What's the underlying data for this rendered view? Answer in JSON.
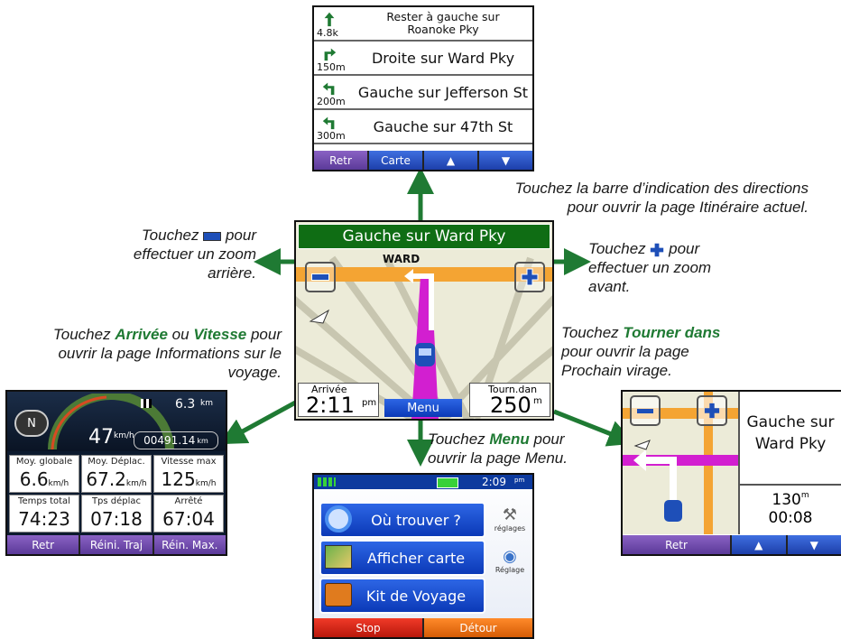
{
  "colors": {
    "arrow": "#1f7a33",
    "accent_green": "#1f7a33",
    "softkey_purple": "#5b3a99",
    "softkey_blue": "#1d3faa"
  },
  "route_screen": {
    "rows": [
      {
        "distance": "4.8k",
        "text": "Rester à gauche sur\nRoanoke Pky",
        "icon": "keep-left-icon"
      },
      {
        "distance": "150m",
        "text": "Droite sur Ward Pky",
        "icon": "turn-right-icon"
      },
      {
        "distance": "200m",
        "text": "Gauche sur Jefferson St",
        "icon": "turn-left-icon"
      },
      {
        "distance": "300m",
        "text": "Gauche sur 47th St",
        "icon": "turn-left-icon"
      }
    ],
    "buttons": {
      "back": "Retr",
      "map": "Carte",
      "up": "▲",
      "down": "▼"
    }
  },
  "map_screen": {
    "banner": "Gauche sur Ward Pky",
    "street_label": "WARD",
    "zoom_out": "−",
    "zoom_in": "+",
    "arrival_label": "Arrivée",
    "arrival_value": "2:11",
    "arrival_unit": "pm",
    "menu": "Menu",
    "turn_label": "Tourn.dan",
    "turn_value": "250",
    "turn_unit": "m"
  },
  "trip_screen": {
    "compass": "N",
    "speed": "47",
    "speed_unit": "km/h",
    "distance": "6.3",
    "distance_unit": "km",
    "odometer": "00491.14",
    "odometer_unit": "km",
    "stats": [
      {
        "label": "Moy. globale",
        "value": "6.6",
        "unit": "km/h"
      },
      {
        "label": "Moy. Déplac.",
        "value": "67.2",
        "unit": "km/h"
      },
      {
        "label": "Vitesse max",
        "value": "125",
        "unit": "km/h"
      },
      {
        "label": "Temps total",
        "value": "74:23",
        "unit": ""
      },
      {
        "label": "Tps déplac",
        "value": "07:18",
        "unit": ""
      },
      {
        "label": "Arrêté",
        "value": "67:04",
        "unit": ""
      }
    ],
    "buttons": {
      "back": "Retr",
      "reset_trip": "Réini. Traj",
      "reset_max": "Réin. Max."
    }
  },
  "menu_screen": {
    "time": "2:09",
    "time_unit": "pm",
    "buttons": [
      "Où trouver ?",
      "Afficher carte",
      "Kit de Voyage"
    ],
    "side": [
      "réglages",
      "Réglage"
    ],
    "stop": "Stop",
    "detour": "Détour"
  },
  "next_turn_screen": {
    "instruction": "Gauche sur\nWard Pky",
    "distance": "130",
    "distance_unit": "m",
    "time": "00:08",
    "buttons": {
      "back": "Retr",
      "up": "▲",
      "down": "▼"
    }
  },
  "captions": {
    "top_1": "Touchez la barre d’indication des directions",
    "top_2": "pour ouvrir la page Itinéraire actuel.",
    "left_zoom_pre": "Touchez",
    "left_zoom_post": "pour",
    "left_zoom_2": "effectuer un zoom",
    "left_zoom_3": "arrière.",
    "right_zoom_pre": "Touchez",
    "right_zoom_post": "pour",
    "right_zoom_2": "effectuer un zoom",
    "right_zoom_3": "avant.",
    "trip_pre": "Touchez",
    "trip_b1": "Arrivée",
    "trip_mid": "ou",
    "trip_b2": "Vitesse",
    "trip_post": "pour",
    "trip_2": "ouvrir la page Informations sur le",
    "trip_3": "voyage.",
    "turn_pre": "Touchez",
    "turn_b": "Tourner dans",
    "turn_2": "pour ouvrir la page",
    "turn_3": "Prochain virage.",
    "menu_pre": "Touchez",
    "menu_b": "Menu",
    "menu_post": "pour",
    "menu_2": "ouvrir la page Menu."
  }
}
